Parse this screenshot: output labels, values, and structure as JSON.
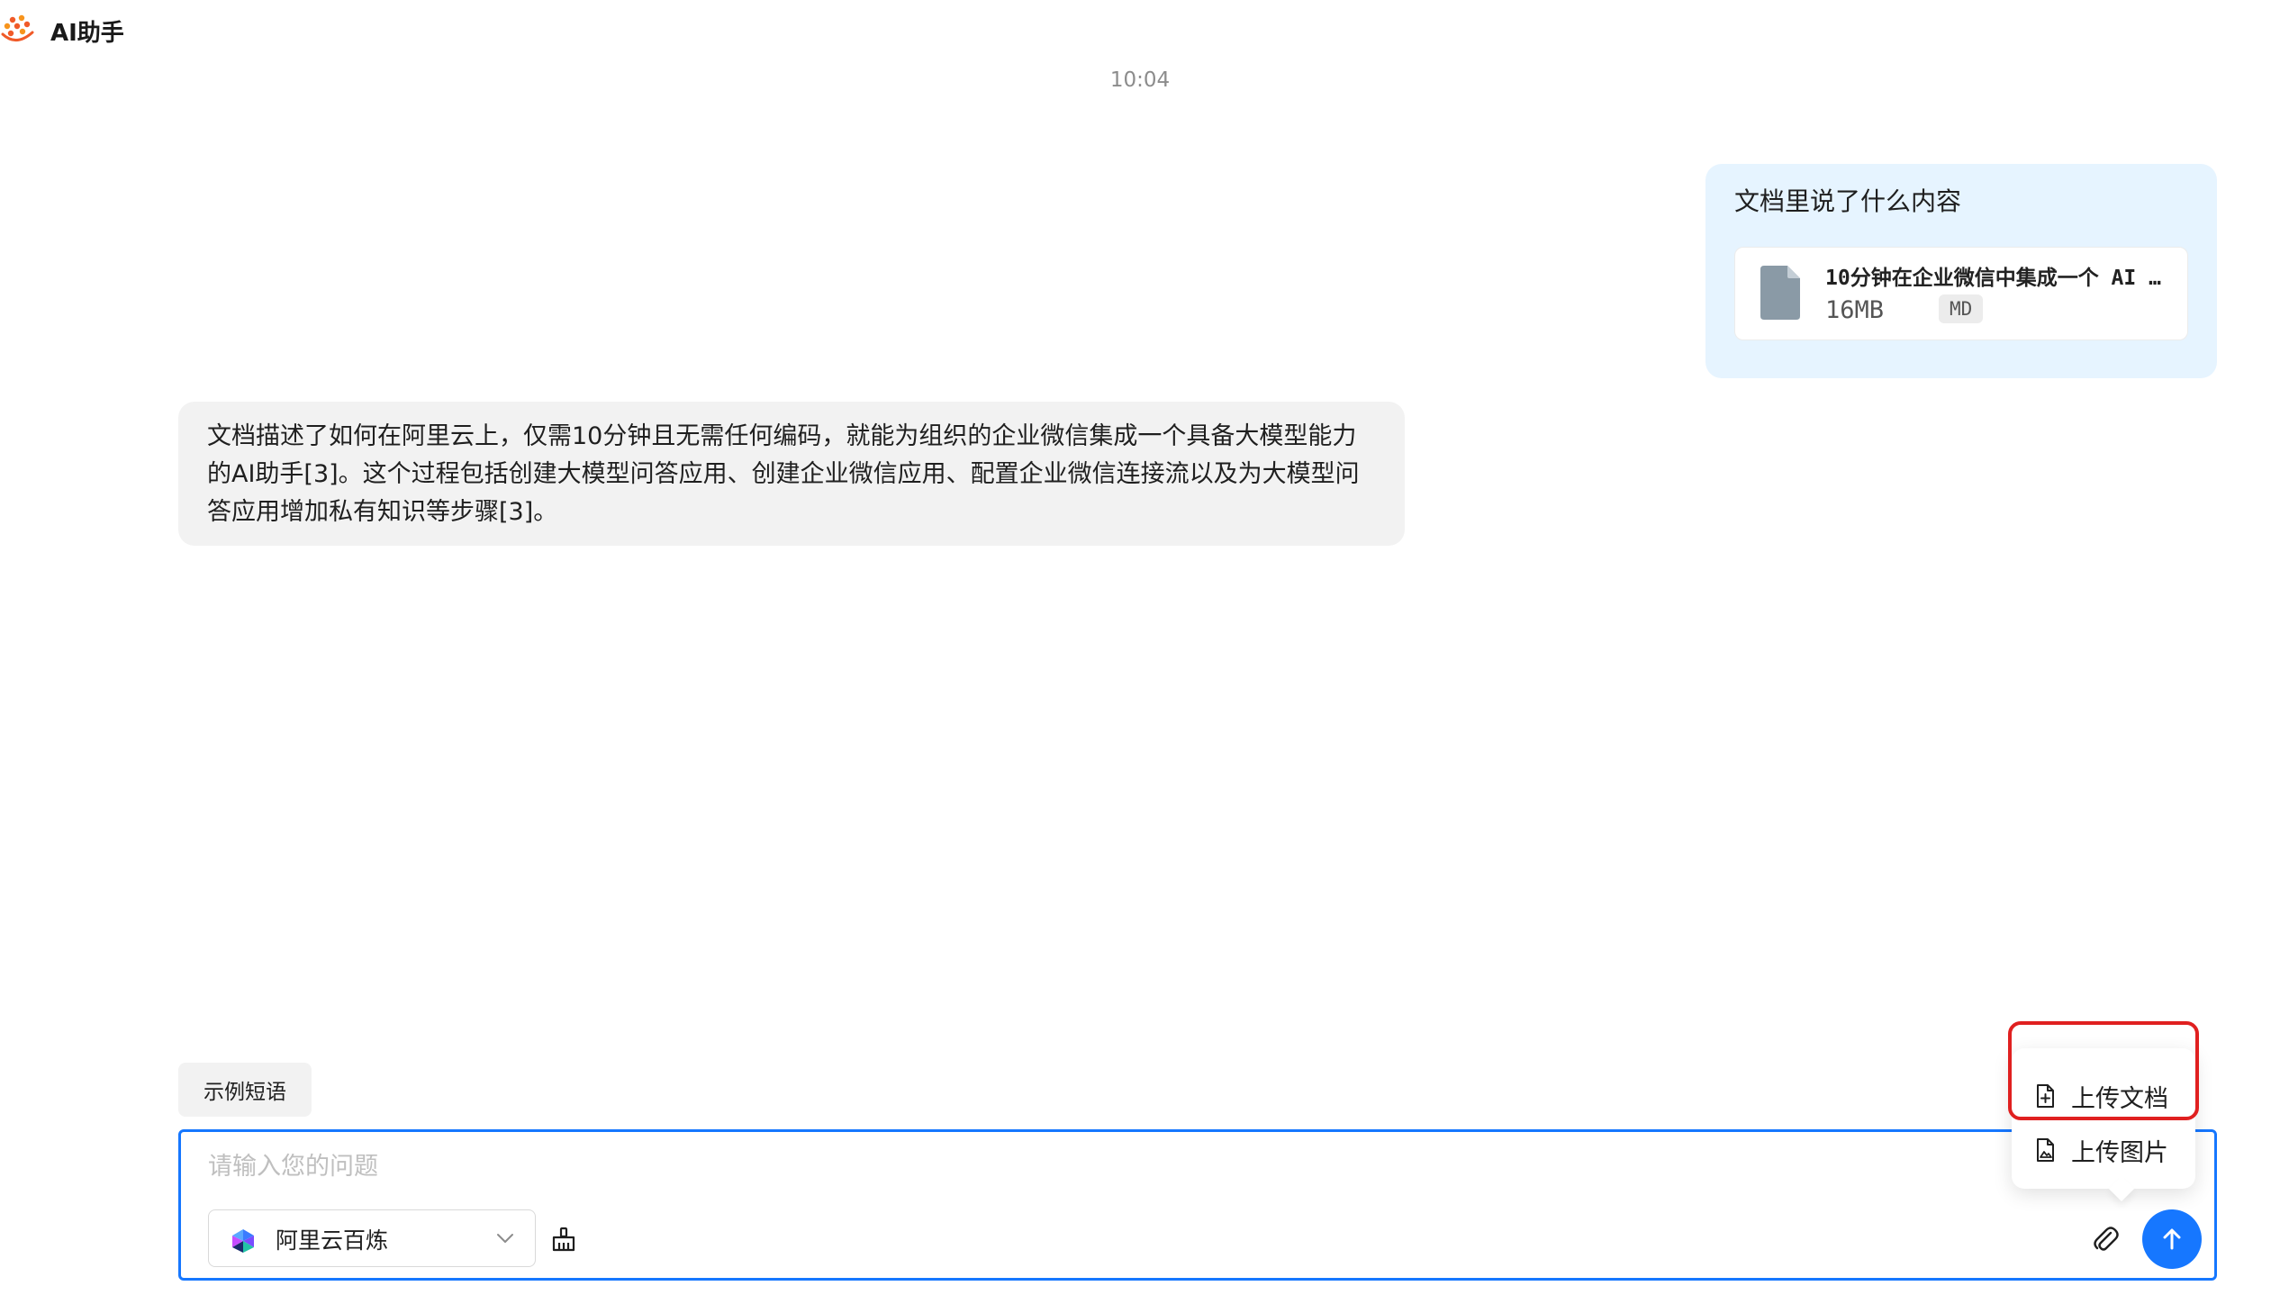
{
  "header": {
    "app_title": "AI助手",
    "logo_icon": "ai-assistant-logo-icon"
  },
  "chat": {
    "timestamp": "10:04",
    "user_message": {
      "text": "文档里说了什么内容",
      "attachment": {
        "name": "10分钟在企业微信中集成一个 AI …",
        "size": "16MB",
        "type": "MD",
        "icon": "file-icon"
      }
    },
    "ai_message": {
      "text": "文档描述了如何在阿里云上，仅需10分钟且无需任何编码，就能为组织的企业微信集成一个具备大模型能力的AI助手[3]。这个过程包括创建大模型问答应用、创建企业微信应用、配置企业微信连接流以及为大模型问答应用增加私有知识等步骤[3]。"
    }
  },
  "example_phrases_label": "示例短语",
  "input": {
    "placeholder": "请输入您的问题",
    "value": "",
    "model_select": {
      "value": "阿里云百炼",
      "icon": "bailian-logo-icon"
    },
    "clear_icon": "broom-icon",
    "attach_icon": "paperclip-icon",
    "send_icon": "arrow-up-icon"
  },
  "upload_menu": {
    "items": [
      {
        "label": "上传文档",
        "icon": "file-add-icon"
      },
      {
        "label": "上传图片",
        "icon": "file-image-icon"
      }
    ],
    "highlighted_item": "上传文档"
  },
  "colors": {
    "accent": "#1677ff",
    "user_bubble_bg": "#e6f4ff",
    "ai_bubble_bg": "#f2f2f2",
    "highlight_border": "#e02020"
  }
}
